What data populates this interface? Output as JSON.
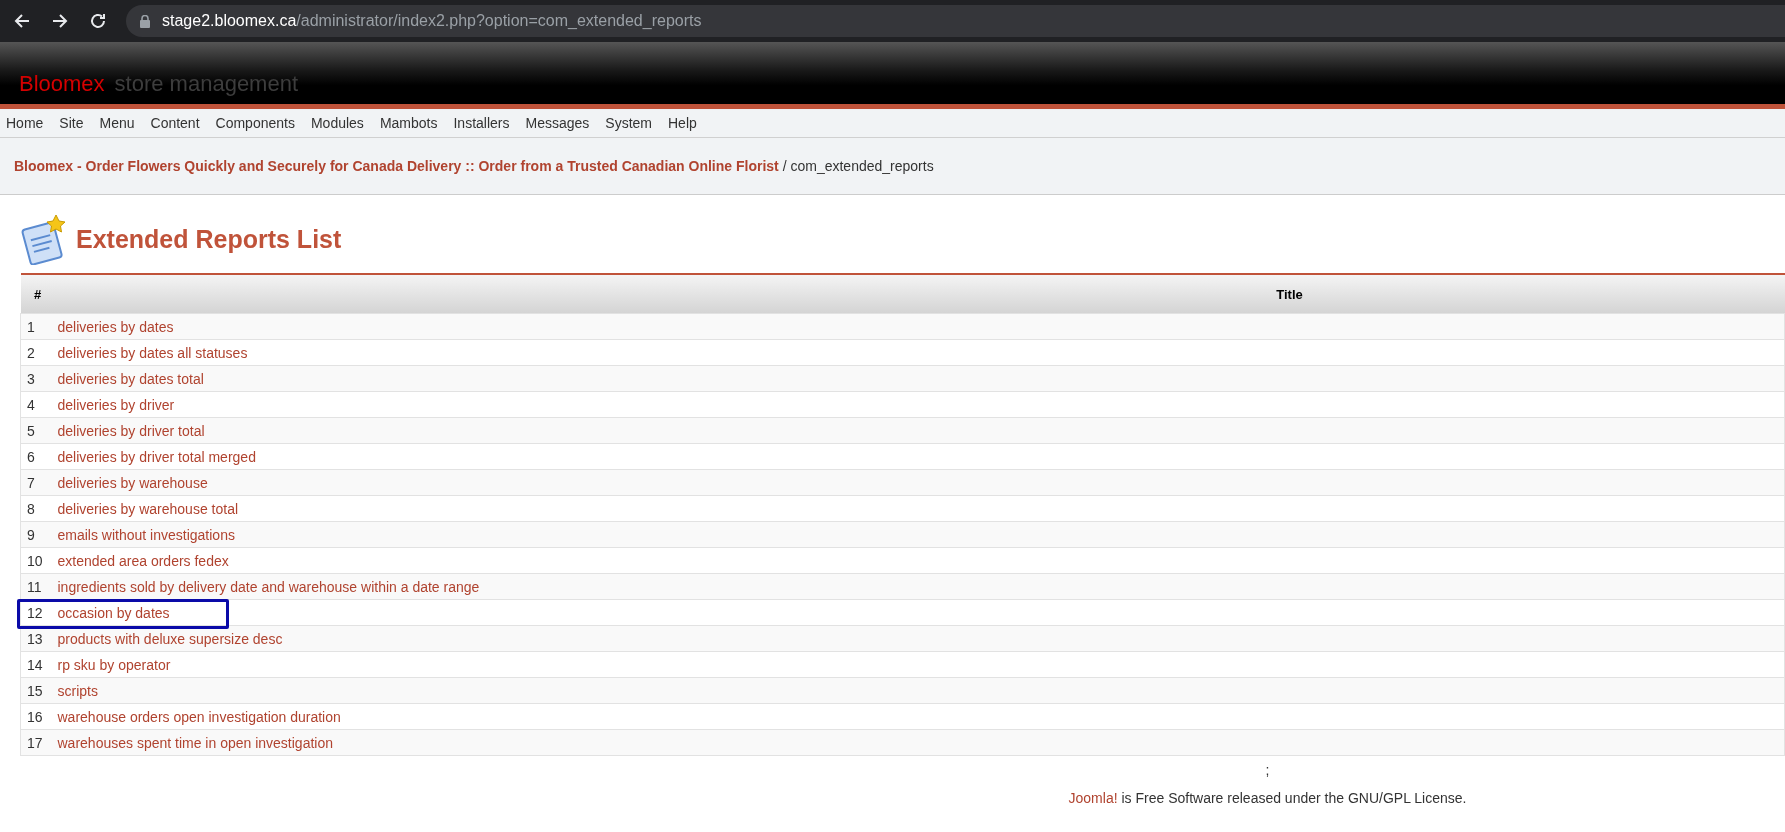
{
  "browser": {
    "url_host": "stage2.bloomex.ca",
    "url_path": "/administrator/index2.php?option=com_extended_reports"
  },
  "header": {
    "brand": "Bloomex",
    "subtitle": "store management"
  },
  "menu": [
    "Home",
    "Site",
    "Menu",
    "Content",
    "Components",
    "Modules",
    "Mambots",
    "Installers",
    "Messages",
    "System",
    "Help"
  ],
  "breadcrumb": {
    "link": "Bloomex - Order Flowers Quickly and Securely for Canada Delivery :: Order from a Trusted Canadian Online Florist",
    "current": " / com_extended_reports"
  },
  "page_title": "Extended Reports List",
  "table": {
    "columns": [
      "#",
      "Title"
    ],
    "rows": [
      {
        "num": "1",
        "title": "deliveries by dates",
        "highlighted": false
      },
      {
        "num": "2",
        "title": "deliveries by dates all statuses",
        "highlighted": false
      },
      {
        "num": "3",
        "title": "deliveries by dates total",
        "highlighted": false
      },
      {
        "num": "4",
        "title": "deliveries by driver",
        "highlighted": false
      },
      {
        "num": "5",
        "title": "deliveries by driver total",
        "highlighted": false
      },
      {
        "num": "6",
        "title": "deliveries by driver total merged",
        "highlighted": false
      },
      {
        "num": "7",
        "title": "deliveries by warehouse",
        "highlighted": false
      },
      {
        "num": "8",
        "title": "deliveries by warehouse total",
        "highlighted": false
      },
      {
        "num": "9",
        "title": "emails without investigations",
        "highlighted": false
      },
      {
        "num": "10",
        "title": "extended area orders fedex",
        "highlighted": false
      },
      {
        "num": "11",
        "title": "ingredients sold by delivery date and warehouse within a date range",
        "highlighted": false
      },
      {
        "num": "12",
        "title": "occasion by dates",
        "highlighted": true
      },
      {
        "num": "13",
        "title": "products with deluxe supersize desc",
        "highlighted": false
      },
      {
        "num": "14",
        "title": "rp sku by operator",
        "highlighted": false
      },
      {
        "num": "15",
        "title": "scripts",
        "highlighted": false
      },
      {
        "num": "16",
        "title": "warehouse orders open investigation duration",
        "highlighted": false
      },
      {
        "num": "17",
        "title": "warehouses spent time in open investigation",
        "highlighted": false
      }
    ]
  },
  "footer": {
    "separator": ";",
    "link": "Joomla!",
    "text": " is Free Software released under the GNU/GPL License."
  }
}
